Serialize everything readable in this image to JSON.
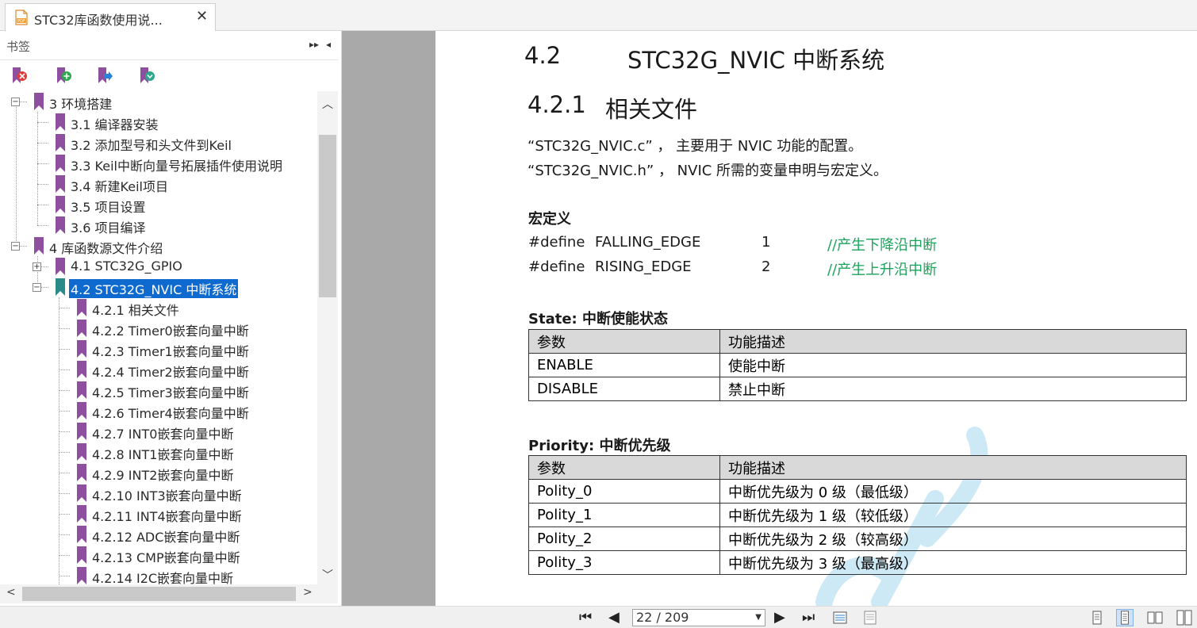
{
  "tab": {
    "title": "STC32库函数使用说...",
    "close": "✕",
    "icon": "pdf-file-icon"
  },
  "sidebar": {
    "title": "书签",
    "expand_ctrl": "▸▸",
    "collapse_ctrl": "◂",
    "tools": [
      "delete-bookmark-icon",
      "add-bookmark-icon",
      "goto-bookmark-icon",
      "expand-bookmark-icon"
    ],
    "tree": [
      {
        "label": "3 环境搭建",
        "level": 0,
        "toggle": "−"
      },
      {
        "label": "3.1 编译器安装",
        "level": 1
      },
      {
        "label": "3.2 添加型号和头文件到Keil",
        "level": 1
      },
      {
        "label": "3.3 Keil中断向量号拓展插件使用说明",
        "level": 1
      },
      {
        "label": "3.4 新建Keil项目",
        "level": 1
      },
      {
        "label": "3.5 项目设置",
        "level": 1
      },
      {
        "label": "3.6 项目编译",
        "level": 1
      },
      {
        "label": "4 库函数源文件介绍",
        "level": 0,
        "toggle": "−"
      },
      {
        "label": "4.1 STC32G_GPIO",
        "level": 1,
        "toggle": "+"
      },
      {
        "label": "4.2 STC32G_NVIC 中断系统",
        "level": 1,
        "toggle": "−",
        "selected": true
      },
      {
        "label": "4.2.1 相关文件",
        "level": 2
      },
      {
        "label": "4.2.2 Timer0嵌套向量中断",
        "level": 2
      },
      {
        "label": "4.2.3 Timer1嵌套向量中断",
        "level": 2
      },
      {
        "label": "4.2.4 Timer2嵌套向量中断",
        "level": 2
      },
      {
        "label": "4.2.5 Timer3嵌套向量中断",
        "level": 2
      },
      {
        "label": "4.2.6 Timer4嵌套向量中断",
        "level": 2
      },
      {
        "label": "4.2.7 INT0嵌套向量中断",
        "level": 2
      },
      {
        "label": "4.2.8 INT1嵌套向量中断",
        "level": 2
      },
      {
        "label": "4.2.9 INT2嵌套向量中断",
        "level": 2
      },
      {
        "label": "4.2.10 INT3嵌套向量中断",
        "level": 2
      },
      {
        "label": "4.2.11 INT4嵌套向量中断",
        "level": 2
      },
      {
        "label": "4.2.12 ADC嵌套向量中断",
        "level": 2
      },
      {
        "label": "4.2.13 CMP嵌套向量中断",
        "level": 2
      },
      {
        "label": "4.2.14 I2C嵌套向量中断",
        "level": 2
      }
    ]
  },
  "document": {
    "h1_num": "4.2",
    "h1_text": "STC32G_NVIC  中断系统",
    "h2_num": "4.2.1",
    "h2_text": "相关文件",
    "file_c": "“STC32G_NVIC.c” ， 主要用于 NVIC 功能的配置。",
    "file_h": "“STC32G_NVIC.h” ， NVIC 所需的变量申明与宏定义。",
    "macro_heading": "宏定义",
    "defines": [
      {
        "kw": "#define",
        "name": "FALLING_EDGE",
        "val": "1",
        "comment": "//产生下降沿中断"
      },
      {
        "kw": "#define",
        "name": "RISING_EDGE",
        "val": "2",
        "comment": "//产生上升沿中断"
      }
    ],
    "state_heading": "State:  中断使能状态",
    "state_table": {
      "headers": [
        "参数",
        "功能描述"
      ],
      "rows": [
        [
          "ENABLE",
          "使能中断"
        ],
        [
          "DISABLE",
          "禁止中断"
        ]
      ]
    },
    "priority_heading": "Priority:  中断优先级",
    "priority_table": {
      "headers": [
        "参数",
        "功能描述"
      ],
      "rows": [
        [
          "Polity_0",
          "中断优先级为 0 级（最低级）"
        ],
        [
          "Polity_1",
          "中断优先级为 1 级（较低级）"
        ],
        [
          "Polity_2",
          "中断优先级为 2 级（较高级）"
        ],
        [
          "Polity_3",
          "中断优先级为 3 级（最高级）"
        ]
      ]
    }
  },
  "statusbar": {
    "page_indicator": "22 / 209",
    "nav": [
      "first-page-icon",
      "prev-page-icon",
      "next-page-icon",
      "last-page-icon"
    ],
    "tools": [
      "fit-width-icon",
      "fit-page-icon"
    ],
    "views": [
      "single-page-icon",
      "continuous-page-icon",
      "two-page-icon",
      "two-page-continuous-icon"
    ]
  },
  "colors": {
    "accent": "#0f6ad0",
    "bookmark": "#8e4f9f",
    "bookmark_selected": "#2a8a8a",
    "comment": "#1aa35a"
  }
}
